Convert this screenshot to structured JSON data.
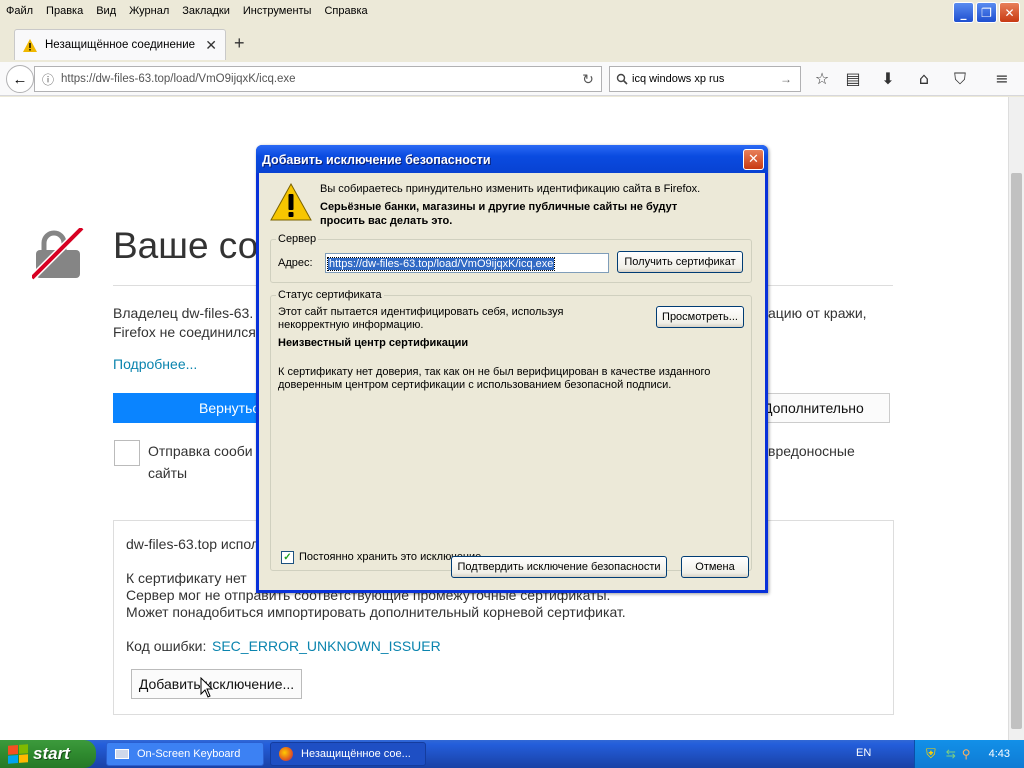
{
  "menu": [
    "Файл",
    "Правка",
    "Вид",
    "Журнал",
    "Закладки",
    "Инструменты",
    "Справка"
  ],
  "tab": {
    "title": "Незащищённое соединение"
  },
  "nav": {
    "url": "https://dw-files-63.top/load/VmO9ijqxK/icq.exe",
    "search": "icq windows xp rus"
  },
  "page": {
    "title": "Ваше со",
    "line1_left": "Владелец dw-files-63.",
    "line1_right": "ацию от кражи,",
    "line2_left": "Firefox не соединился",
    "more_link": "Подробнее...",
    "back_button": "Вернуться",
    "advanced_button": "Дополнительно",
    "report_left": "Отправка сооби",
    "report_right": "вредоносные",
    "report_line2": "сайты",
    "adv_line1": "dw-files-63.top испол",
    "adv_line2": "К сертификату нет",
    "adv_line3": "Сервер мог не отправить соответствующие промежуточные сертификаты.",
    "adv_line4": "Может понадобиться импортировать дополнительный корневой сертификат.",
    "error_label": "Код ошибки:",
    "error_code": "SEC_ERROR_UNKNOWN_ISSUER",
    "add_exception_button": "Добавить исключение..."
  },
  "dialog": {
    "title": "Добавить исключение безопасности",
    "intro": "Вы собираетесь принудительно изменить идентификацию сайта в Firefox.",
    "warning_line1": "Серьёзные банки, магазины и другие публичные сайты не будут",
    "warning_line2": "просить вас делать это.",
    "server_group": "Сервер",
    "address_label": "Адрес:",
    "address_value": "https://dw-files-63.top/load/VmO9ijqxK/icq.exe",
    "get_cert_button": "Получить сертификат",
    "status_group": "Статус сертификата",
    "status_line1": "Этот сайт пытается идентифицировать себя, используя",
    "status_line2": "некорректную информацию.",
    "view_button": "Просмотреть...",
    "unknown_ca": "Неизвестный центр сертификации",
    "ca_desc1": "К сертификату нет доверия, так как он не был верифицирован в качестве изданного",
    "ca_desc2": "доверенным центром сертификации с использованием безопасной подписи.",
    "permanent_label": "Постоянно хранить это исключение",
    "permanent_checked": true,
    "confirm_button": "Подтвердить исключение безопасности",
    "cancel_button": "Отмена"
  },
  "taskbar": {
    "start": "start",
    "tasks": [
      "On-Screen Keyboard",
      "Незащищённое сое..."
    ],
    "lang": "EN",
    "time": "4:43"
  }
}
